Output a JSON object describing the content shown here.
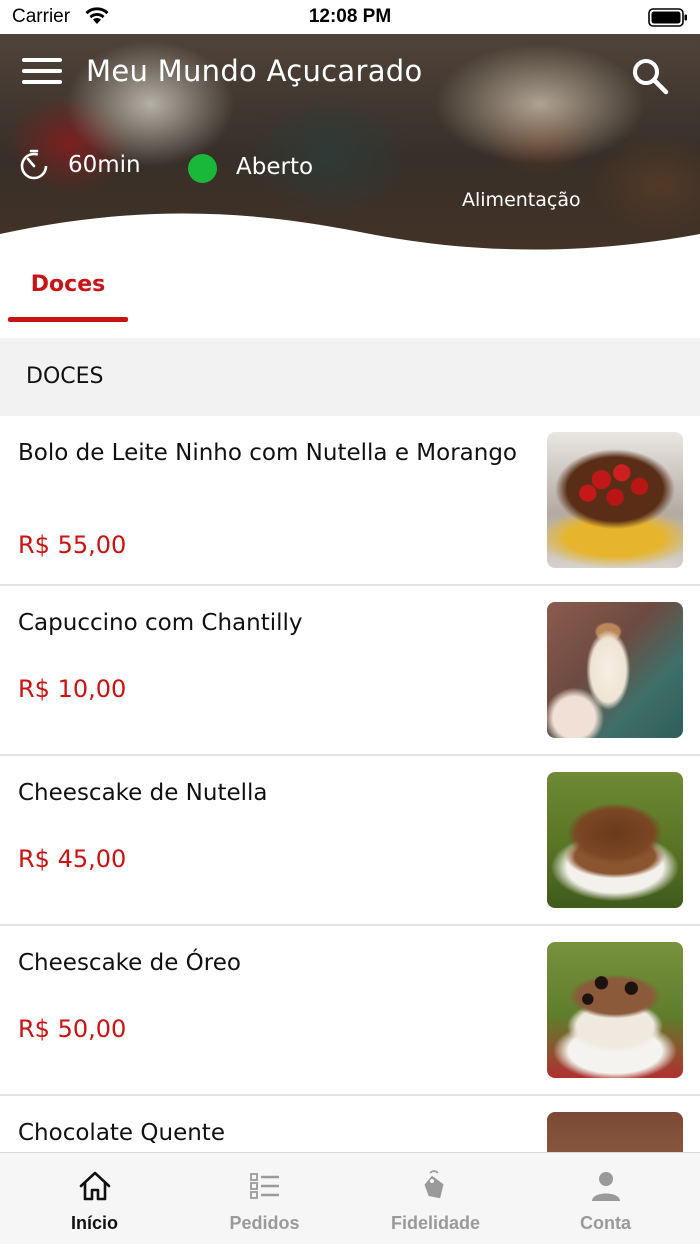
{
  "status_bar": {
    "carrier": "Carrier",
    "time": "12:08 PM"
  },
  "header": {
    "store_name": "Meu Mundo Açucarado",
    "delivery_time": "60min",
    "status": "Aberto",
    "status_color": "#19b83a",
    "category": "Alimentação"
  },
  "tabs": [
    {
      "label": "Doces",
      "active": true
    }
  ],
  "section": {
    "title": "DOCES"
  },
  "products": [
    {
      "name": "Bolo de Leite Ninho com Nutella e Morango",
      "price": "R$ 55,00",
      "image": "bolo-image"
    },
    {
      "name": "Capuccino com Chantilly",
      "price": "R$ 10,00",
      "image": "capuccino-image"
    },
    {
      "name": "Cheescake de Nutella",
      "price": "R$ 45,00",
      "image": "cheesecake-nutella-image"
    },
    {
      "name": "Cheescake de Óreo",
      "price": "R$ 50,00",
      "image": "cheesecake-oreo-image"
    },
    {
      "name": "Chocolate Quente",
      "price": "",
      "image": "chocolate-quente-image"
    }
  ],
  "tab_bar": {
    "items": [
      {
        "label": "Início",
        "icon": "home-icon",
        "active": true
      },
      {
        "label": "Pedidos",
        "icon": "list-icon",
        "active": false
      },
      {
        "label": "Fidelidade",
        "icon": "tag-icon",
        "active": false
      },
      {
        "label": "Conta",
        "icon": "person-icon",
        "active": false
      }
    ]
  },
  "colors": {
    "accent": "#c81414",
    "price": "#cc1111",
    "open": "#19b83a",
    "tab_active": "#111111",
    "tab_inactive": "#9a9a9a"
  }
}
